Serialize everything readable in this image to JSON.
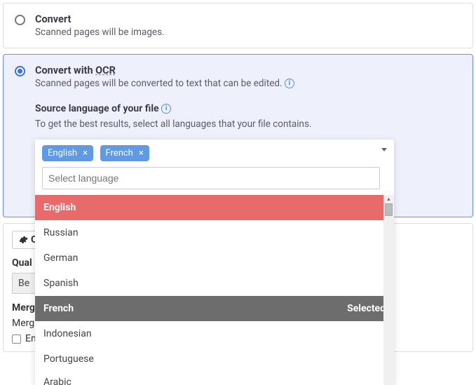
{
  "options": {
    "convert": {
      "title": "Convert",
      "desc": "Scanned pages will be images."
    },
    "ocr": {
      "title_prefix": "Convert with ",
      "title_ocr": "OCR",
      "desc": "Scanned pages will be converted to text that can be edited.",
      "source_label": "Source language of your file",
      "source_help": "To get the best results, select all languages that your file contains."
    }
  },
  "lang": {
    "chips": [
      "English",
      "French"
    ],
    "placeholder": "Select language",
    "list": [
      {
        "name": "English",
        "state": "hl"
      },
      {
        "name": "Russian",
        "state": ""
      },
      {
        "name": "German",
        "state": ""
      },
      {
        "name": "Spanish",
        "state": ""
      },
      {
        "name": "French",
        "state": "sel",
        "badge": "Selected"
      },
      {
        "name": "Indonesian",
        "state": ""
      },
      {
        "name": "Portuguese",
        "state": ""
      },
      {
        "name": "Arabic",
        "state": "cut"
      }
    ]
  },
  "options_panel": {
    "button": "Op",
    "quality_label": "Qual",
    "quality_value": "Be",
    "merge_header": "Merg",
    "merge_desc": "Merg",
    "enable_merge": "Enable Merge"
  }
}
